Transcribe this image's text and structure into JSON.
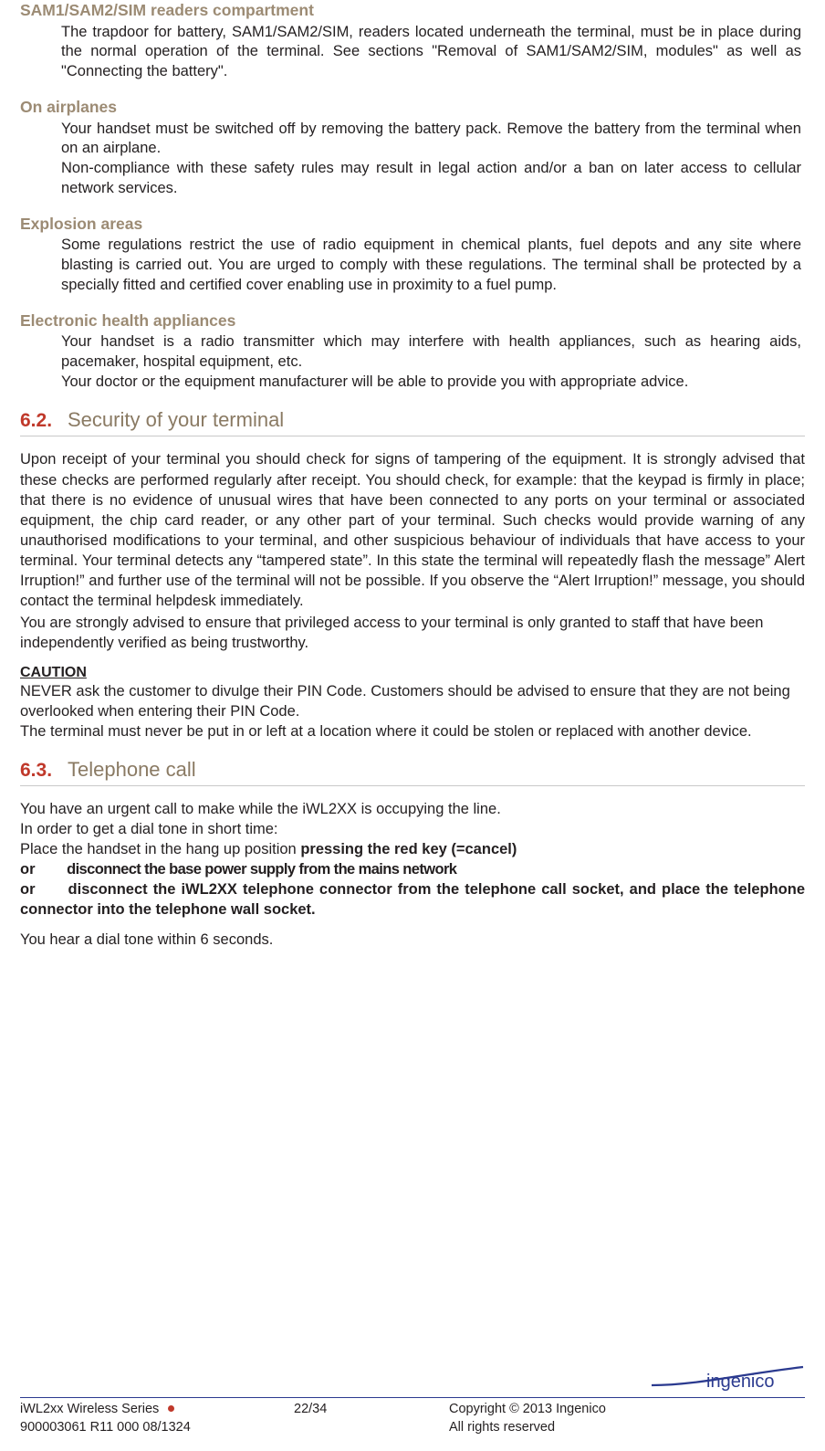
{
  "sections": [
    {
      "heading": "SAM1/SAM2/SIM readers compartment",
      "paragraphs": [
        "The trapdoor for battery, SAM1/SAM2/SIM, readers located underneath the terminal, must be in place during the normal operation of the terminal. See sections \"Removal of SAM1/SAM2/SIM, modules\" as well as \"Connecting the battery\"."
      ]
    },
    {
      "heading": "On airplanes",
      "paragraphs": [
        "Your handset must be switched off by removing the battery pack. Remove the battery from the terminal when on an airplane.",
        "Non-compliance with these safety rules may result in legal action and/or a ban on later access to cellular network services."
      ]
    },
    {
      "heading": "Explosion areas",
      "paragraphs": [
        "Some regulations restrict the use of radio equipment in chemical plants, fuel depots and any site where blasting is carried out. You are urged to comply with these regulations. The terminal shall be protected by a specially fitted and certified cover enabling use in proximity to a fuel pump."
      ]
    },
    {
      "heading": "Electronic health appliances",
      "paragraphs": [
        "Your handset is a radio transmitter which may interfere with health appliances, such as hearing aids, pacemaker, hospital equipment, etc.",
        "Your doctor or the equipment manufacturer will be able to provide you with appropriate advice."
      ]
    }
  ],
  "security_section": {
    "number": "6.2.",
    "title": "Security of your terminal",
    "paragraph1": "Upon receipt of your terminal you should check for signs of tampering of the equipment. It is strongly advised that these checks are performed regularly after receipt. You should check, for example: that the keypad is firmly in place; that there is no evidence of unusual wires that have been connected to any ports on your terminal or associated equipment, the chip card reader, or any other part of your terminal. Such checks would provide warning of any unauthorised modifications to your terminal, and other suspicious behaviour of individuals that have access to your terminal. Your terminal detects any “tampered state”. In this state the terminal will repeatedly flash the message” Alert Irruption!” and further use of the terminal will not be possible. If you observe the “Alert Irruption!” message, you should contact the terminal helpdesk immediately.",
    "paragraph2": "You are strongly advised to ensure that privileged access to your terminal is only granted to staff that have been independently verified as being trustworthy.",
    "caution_label": "CAUTION",
    "caution_line1": "NEVER ask the customer to divulge their PIN Code. Customers should be advised to ensure that they are not being overlooked when entering their PIN Code.",
    "caution_line2": "The terminal must never be put in or left at a location where it could be stolen or replaced with another device."
  },
  "telephone_section": {
    "number": "6.3.",
    "title": "Telephone call",
    "line1": "You have an urgent call to make while the iWL2XX  is occupying the line.",
    "line2": "In order to get a dial tone in short time:",
    "line3_plain": "Place the handset in the hang up position ",
    "line3_bold": "pressing the red key (=cancel)",
    "line4_or": "or",
    "line4_bold": "disconnect the base power supply from the mains network",
    "line5_or": "or",
    "line5_bold": "disconnect the iWL2XX telephone connector from the telephone call socket, and place the telephone connector into the telephone wall socket.",
    "line6": "You hear a dial tone within 6 seconds."
  },
  "footer": {
    "left_line1": "iWL2xx Wireless Series",
    "left_line2": "900003061 R11 000 08/1324",
    "page": "22/34",
    "right_line1": "Copyright © 2013 Ingenico",
    "right_line2": "All rights reserved",
    "brand": "ingenico",
    "dot_color": "#c0392b",
    "rule_color": "#2b3a8f"
  }
}
